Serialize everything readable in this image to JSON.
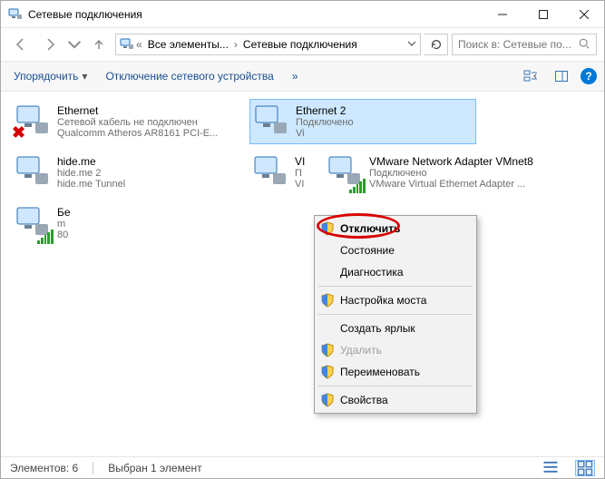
{
  "window": {
    "title": "Сетевые подключения"
  },
  "breadcrumb": {
    "seg1": "Все элементы...",
    "seg2": "Сетевые подключения"
  },
  "search": {
    "placeholder": "Поиск в: Сетевые по..."
  },
  "commandbar": {
    "organize": "Упорядочить",
    "disable_device": "Отключение сетевого устройства",
    "more": "»"
  },
  "adapters": [
    {
      "name": "Ethernet",
      "line2": "Сетевой кабель не подключен",
      "line3": "Qualcomm Atheros AR8161 PCI-E...",
      "status": "disconnected",
      "selected": false
    },
    {
      "name": "Ethernet 2",
      "line2": "Подключено",
      "line3": "Vi",
      "status": "connected",
      "selected": true
    },
    {
      "name": "hide.me",
      "line2": "hide.me 2",
      "line3": "hide.me Tunnel",
      "status": "normal",
      "selected": false
    },
    {
      "name": "VI",
      "line2": "П",
      "line3": "VI",
      "status": "normal",
      "selected": false
    },
    {
      "name": "VMware Network Adapter VMnet8",
      "line2": "Подключено",
      "line3": "VMware Virtual Ethernet Adapter ...",
      "status": "signal",
      "selected": false
    },
    {
      "name": "Бе",
      "line2": "m",
      "line3": "80",
      "status": "signal",
      "selected": false
    }
  ],
  "context_menu": {
    "disable": "Отключить",
    "status": "Состояние",
    "diagnose": "Диагностика",
    "bridge": "Настройка моста",
    "shortcut": "Создать ярлык",
    "delete": "Удалить",
    "rename": "Переименовать",
    "properties": "Свойства"
  },
  "statusbar": {
    "elements": "Элементов: 6",
    "selected": "Выбран 1 элемент"
  }
}
